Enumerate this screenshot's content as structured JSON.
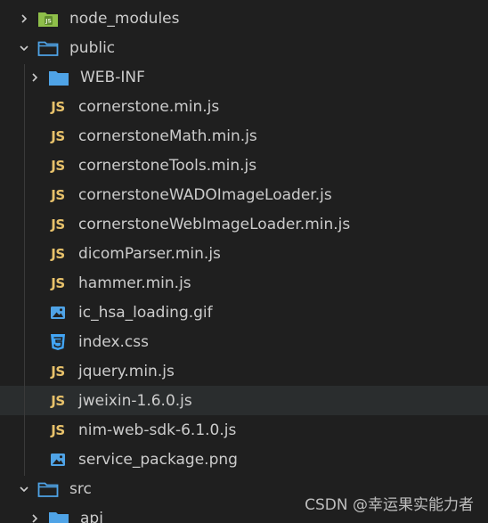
{
  "tree": {
    "root_folder_1": {
      "label": "node_modules",
      "icon": "node-modules-folder-icon",
      "expanded": false
    },
    "root_folder_2": {
      "label": "public",
      "icon": "folder-open-icon",
      "expanded": true
    },
    "public_children": [
      {
        "label": "WEB-INF",
        "type": "folder",
        "icon": "folder-icon"
      },
      {
        "label": "cornerstone.min.js",
        "type": "js",
        "icon_text": "JS"
      },
      {
        "label": "cornerstoneMath.min.js",
        "type": "js",
        "icon_text": "JS"
      },
      {
        "label": "cornerstoneTools.min.js",
        "type": "js",
        "icon_text": "JS"
      },
      {
        "label": "cornerstoneWADOImageLoader.js",
        "type": "js",
        "icon_text": "JS"
      },
      {
        "label": "cornerstoneWebImageLoader.min.js",
        "type": "js",
        "icon_text": "JS"
      },
      {
        "label": "dicomParser.min.js",
        "type": "js",
        "icon_text": "JS"
      },
      {
        "label": "hammer.min.js",
        "type": "js",
        "icon_text": "JS"
      },
      {
        "label": "ic_hsa_loading.gif",
        "type": "image",
        "icon": "image-icon"
      },
      {
        "label": "index.css",
        "type": "css",
        "icon": "css-icon"
      },
      {
        "label": "jquery.min.js",
        "type": "js",
        "icon_text": "JS"
      },
      {
        "label": "jweixin-1.6.0.js",
        "type": "js",
        "icon_text": "JS"
      },
      {
        "label": "nim-web-sdk-6.1.0.js",
        "type": "js",
        "icon_text": "JS"
      },
      {
        "label": "service_package.png",
        "type": "image",
        "icon": "image-icon"
      }
    ],
    "root_folder_3": {
      "label": "src",
      "icon": "folder-icon",
      "expanded": true
    },
    "src_children": [
      {
        "label": "api",
        "type": "folder",
        "icon": "folder-icon"
      }
    ],
    "selected_label": "jweixin-1.6.0.js"
  },
  "watermark": "CSDN @幸运果实能力者",
  "colors": {
    "background": "#1f1f1f",
    "selected_row": "#2a2d2e",
    "js_icon": "#e8c26b",
    "folder_icon": "#4fa3e6",
    "node_icon": "#8fbf4a",
    "text": "#cccccc"
  }
}
